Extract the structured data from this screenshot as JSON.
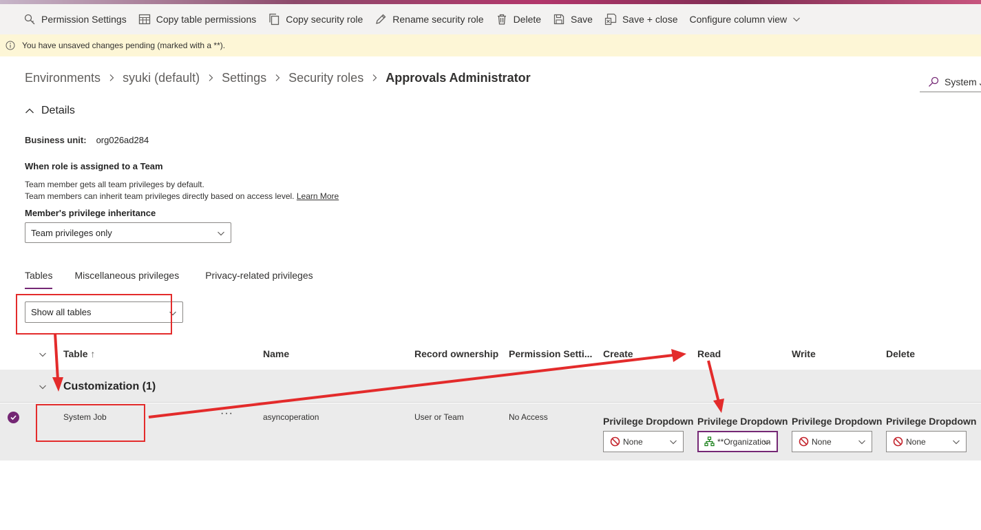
{
  "commandbar": {
    "items": [
      {
        "label": "Permission Settings",
        "icon": "permission-settings-icon"
      },
      {
        "label": "Copy table permissions",
        "icon": "table-icon"
      },
      {
        "label": "Copy security role",
        "icon": "copy-icon"
      },
      {
        "label": "Rename security role",
        "icon": "pencil-icon"
      },
      {
        "label": "Delete",
        "icon": "trash-icon"
      },
      {
        "label": "Save",
        "icon": "save-icon"
      },
      {
        "label": "Save + close",
        "icon": "save-close-icon"
      },
      {
        "label": "Configure column view",
        "icon": "chevron-down-icon"
      }
    ]
  },
  "infobar": {
    "message": "You have unsaved changes pending (marked with a **)."
  },
  "breadcrumb": {
    "items": [
      "Environments",
      "syuki (default)",
      "Settings",
      "Security roles"
    ],
    "current": "Approvals Administrator"
  },
  "search": {
    "text": "System J"
  },
  "details": {
    "title": "Details",
    "business_unit_label": "Business unit:",
    "business_unit_value": "org026ad284",
    "team_title": "When role is assigned to a Team",
    "team_desc_1": "Team member gets all team privileges by default.",
    "team_desc_2": "Team members can inherit team privileges directly based on access level.",
    "learn_more": "Learn More",
    "inheritance_label": "Member's privilege inheritance",
    "inheritance_value": "Team privileges only"
  },
  "tabs": [
    {
      "label": "Tables",
      "active": true
    },
    {
      "label": "Miscellaneous privileges",
      "active": false
    },
    {
      "label": "Privacy-related privileges",
      "active": false
    }
  ],
  "filter": {
    "value": "Show all tables"
  },
  "grid": {
    "columns": {
      "table": "Table",
      "name": "Name",
      "ownership": "Record ownership",
      "permission": "Permission Setti...",
      "create": "Create",
      "read": "Read",
      "write": "Write",
      "delete": "Delete"
    },
    "group": {
      "label": "Customization (1)"
    },
    "row": {
      "table": "System Job",
      "more": "···",
      "name": "asyncoperation",
      "ownership": "User or Team",
      "permission": "No Access",
      "privilege_label": "Privilege Dropdown",
      "create": "None",
      "read": "**Organization",
      "write": "None",
      "delete": "None"
    }
  },
  "colors": {
    "accent": "#742774",
    "annotation": "#e32b2b",
    "infobar": "#fdf6d6"
  }
}
